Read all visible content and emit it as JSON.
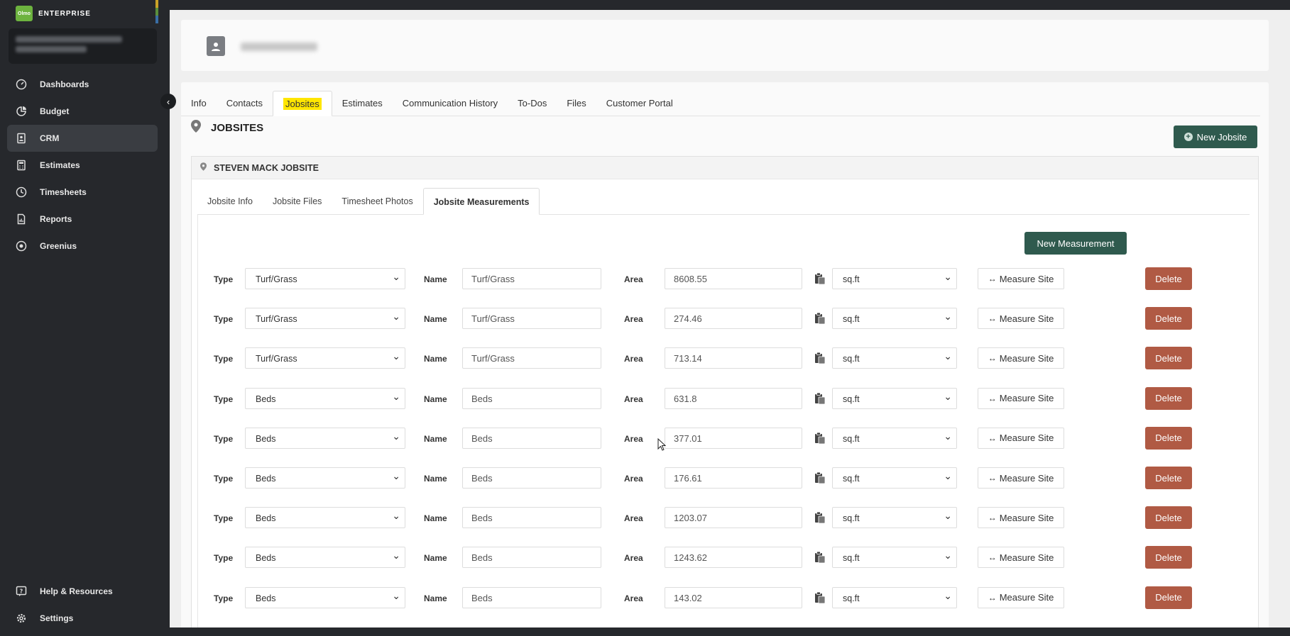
{
  "brand": {
    "logo_text": "Olmo",
    "name": "ENTERPRISE"
  },
  "sidebar": {
    "items": [
      {
        "label": "Dashboards",
        "icon": "dashboard-icon",
        "active": false
      },
      {
        "label": "Budget",
        "icon": "pie-chart-icon",
        "active": false
      },
      {
        "label": "CRM",
        "icon": "contact-book-icon",
        "active": true
      },
      {
        "label": "Estimates",
        "icon": "calculator-icon",
        "active": false
      },
      {
        "label": "Timesheets",
        "icon": "clock-icon",
        "active": false
      },
      {
        "label": "Reports",
        "icon": "report-icon",
        "active": false
      },
      {
        "label": "Greenius",
        "icon": "play-circle-icon",
        "active": false
      }
    ],
    "bottom_items": [
      {
        "label": "Help & Resources",
        "icon": "help-icon"
      },
      {
        "label": "Settings",
        "icon": "gear-icon"
      }
    ]
  },
  "tabs": [
    "Info",
    "Contacts",
    "Jobsites",
    "Estimates",
    "Communication History",
    "To-Dos",
    "Files",
    "Customer Portal"
  ],
  "active_tab": "Jobsites",
  "section": {
    "title": "JOBSITES",
    "new_button": "New Jobsite"
  },
  "jobsite": {
    "name": "STEVEN MACK JOBSITE",
    "tabs": [
      "Jobsite Info",
      "Jobsite Files",
      "Timesheet Photos",
      "Jobsite Measurements"
    ],
    "active_tab": "Jobsite Measurements",
    "new_measurement_button": "New Measurement",
    "labels": {
      "type": "Type",
      "name": "Name",
      "area": "Area",
      "measure": "Measure Site",
      "delete": "Delete"
    },
    "measurements": [
      {
        "type": "Turf/Grass",
        "name": "Turf/Grass",
        "area": "8608.55",
        "unit": "sq.ft"
      },
      {
        "type": "Turf/Grass",
        "name": "Turf/Grass",
        "area": "274.46",
        "unit": "sq.ft"
      },
      {
        "type": "Turf/Grass",
        "name": "Turf/Grass",
        "area": "713.14",
        "unit": "sq.ft"
      },
      {
        "type": "Beds",
        "name": "Beds",
        "area": "631.8",
        "unit": "sq.ft"
      },
      {
        "type": "Beds",
        "name": "Beds",
        "area": "377.01",
        "unit": "sq.ft"
      },
      {
        "type": "Beds",
        "name": "Beds",
        "area": "176.61",
        "unit": "sq.ft"
      },
      {
        "type": "Beds",
        "name": "Beds",
        "area": "1203.07",
        "unit": "sq.ft"
      },
      {
        "type": "Beds",
        "name": "Beds",
        "area": "1243.62",
        "unit": "sq.ft"
      },
      {
        "type": "Beds",
        "name": "Beds",
        "area": "143.02",
        "unit": "sq.ft"
      }
    ]
  },
  "colors": {
    "accent_green": "#2f5a4e",
    "delete_red": "#b05a44",
    "tab_highlight": "#ffe600",
    "brand_green": "#6db33f"
  }
}
